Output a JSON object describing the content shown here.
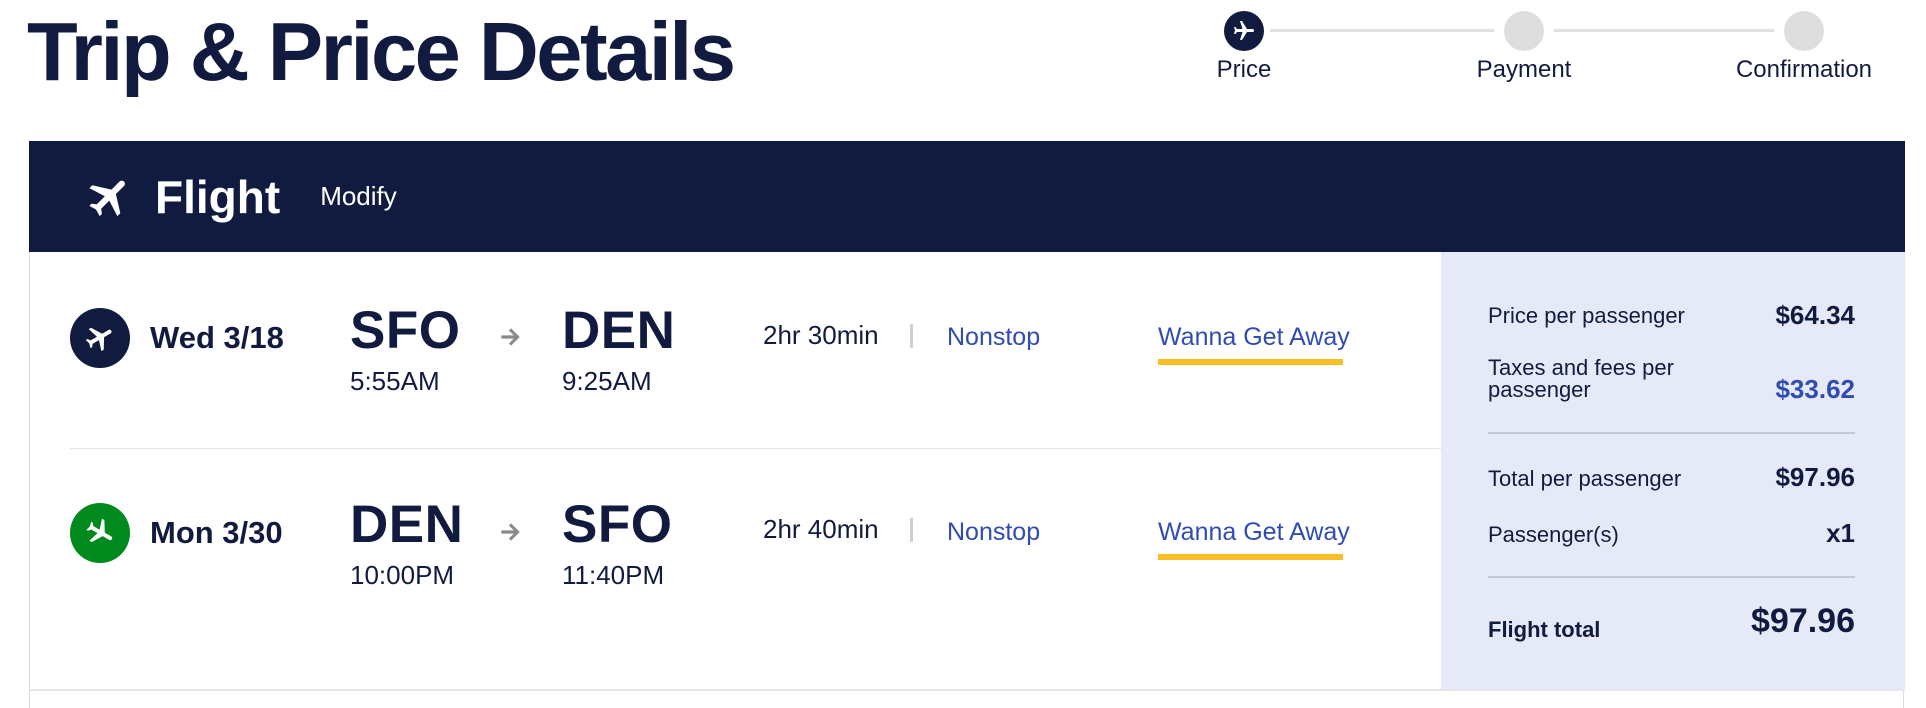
{
  "page_title": "Trip & Price Details",
  "stepper": {
    "steps": [
      {
        "label": "Price",
        "state": "active"
      },
      {
        "label": "Payment",
        "state": "pending"
      },
      {
        "label": "Confirmation",
        "state": "pending"
      }
    ]
  },
  "flight_bar": {
    "title": "Flight",
    "modify_label": "Modify",
    "icon": "airplane-icon"
  },
  "legs": [
    {
      "date": "Wed 3/18",
      "icon_color": "#111b40",
      "origin": "SFO",
      "depart_time": "5:55AM",
      "destination": "DEN",
      "arrive_time": "9:25AM",
      "duration": "2hr 30min",
      "stops": "Nonstop",
      "fare": "Wanna Get Away"
    },
    {
      "date": "Mon 3/30",
      "icon_color": "#008a1d",
      "origin": "DEN",
      "depart_time": "10:00PM",
      "destination": "SFO",
      "arrive_time": "11:40PM",
      "duration": "2hr 40min",
      "stops": "Nonstop",
      "fare": "Wanna Get Away"
    }
  ],
  "price_summary": {
    "price_per_passenger_label": "Price per passenger",
    "price_per_passenger": "$64.34",
    "taxes_line1": "Taxes and fees per",
    "taxes_line2": "passenger",
    "taxes": "$33.62",
    "total_per_passenger_label": "Total per passenger",
    "total_per_passenger": "$97.96",
    "passengers_label": "Passenger(s)",
    "passengers": "x1",
    "flight_total_label": "Flight total",
    "flight_total": "$97.96"
  },
  "colors": {
    "navy": "#111b40",
    "link_blue": "#304cb2",
    "fare_yellow": "#f9bd25",
    "return_green": "#008a1d",
    "panel_bg": "#e6eaf8"
  }
}
